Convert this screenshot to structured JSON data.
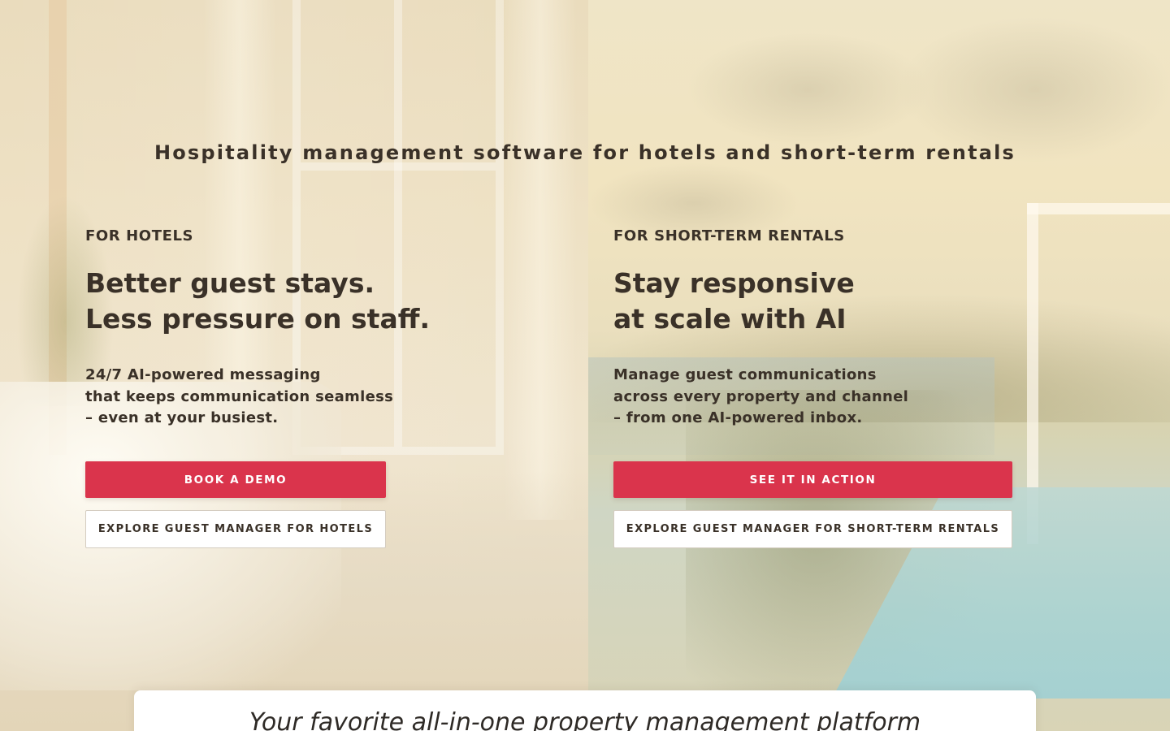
{
  "headline": "Hospitality management software for hotels and short-term rentals",
  "hotels": {
    "eyebrow": "FOR HOTELS",
    "title_line1": "Better guest stays.",
    "title_line2": "Less pressure on staff.",
    "desc_line1": "24/7 AI-powered messaging",
    "desc_line2": "that keeps communication seamless",
    "desc_line3": "– even at your busiest.",
    "primary_label": "BOOK A DEMO",
    "secondary_label": "EXPLORE GUEST MANAGER FOR HOTELS"
  },
  "rentals": {
    "eyebrow": "FOR SHORT-TERM RENTALS",
    "title_line1": "Stay responsive",
    "title_line2": "at scale with AI",
    "desc_line1": "Manage guest communications",
    "desc_line2": "across every property and channel",
    "desc_line3": "– from one AI-powered inbox.",
    "primary_label": "SEE IT IN ACTION",
    "secondary_label": "EXPLORE GUEST MANAGER FOR SHORT-TERM RENTALS"
  },
  "bottom_card": {
    "tagline": "Your favorite all-in-one property management platform"
  },
  "colors": {
    "accent": "#da344c",
    "text": "#3a3128",
    "card": "#ffffff"
  }
}
